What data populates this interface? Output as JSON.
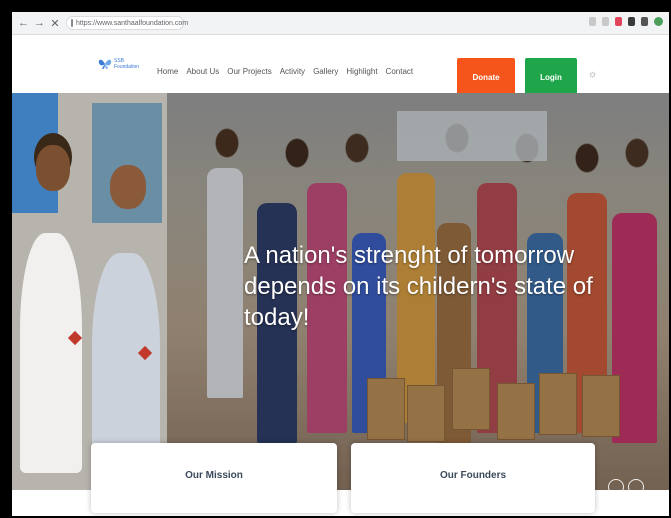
{
  "browser": {
    "nav_back": "←",
    "nav_forward": "→",
    "nav_close": "✕",
    "url": "https://www.santhaalfoundation.com"
  },
  "header": {
    "logo_text": "SSB Foundation",
    "menu": [
      {
        "label": "Home"
      },
      {
        "label": "About Us"
      },
      {
        "label": "Our Projects"
      },
      {
        "label": "Activity"
      },
      {
        "label": "Gallery"
      },
      {
        "label": "Highlight"
      },
      {
        "label": "Contact"
      }
    ],
    "donate_label": "Donate",
    "login_label": "Login",
    "extra_icon": "☼"
  },
  "hero": {
    "headline": "A nation's strenght of tomorrow depends on its childern's state of today!"
  },
  "cards": {
    "mission_title": "Our Mission",
    "founders_title": "Our Founders"
  },
  "colors": {
    "donate": "#f5541b",
    "login": "#1fa64a",
    "brand": "#3a7bd5"
  }
}
